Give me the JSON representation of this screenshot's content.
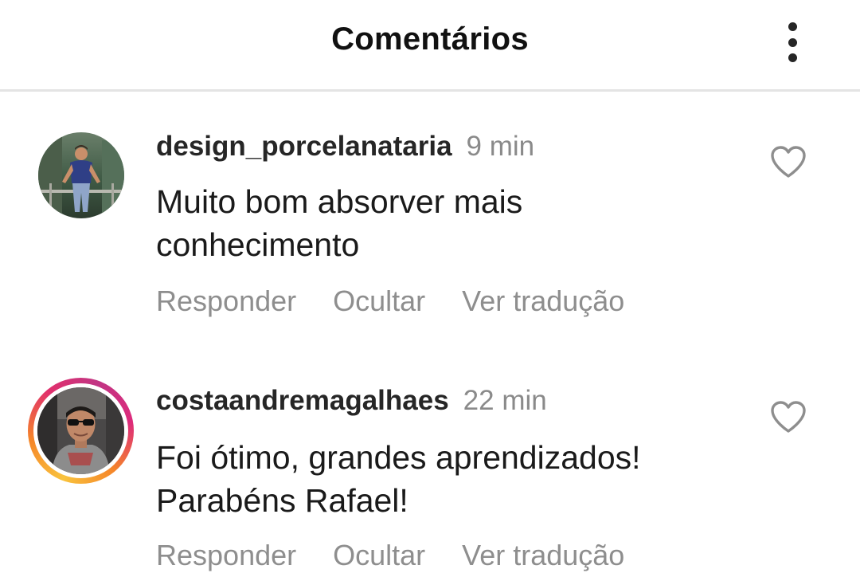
{
  "header": {
    "title": "Comentários",
    "more_icon": "more-vertical-icon"
  },
  "comments": [
    {
      "username": "design_porcelanataria",
      "time": "9 min",
      "text": "Muito bom absorver mais conhecimento",
      "reply_label": "Responder",
      "hide_label": "Ocultar",
      "translate_label": "Ver tradução",
      "has_story_ring": false,
      "like_icon": "heart-outline-icon"
    },
    {
      "username": "costaandremagalhaes",
      "time": "22 min",
      "text": "Foi ótimo, grandes aprendizados! Parabéns Rafael!",
      "reply_label": "Responder",
      "hide_label": "Ocultar",
      "translate_label": "Ver tradução",
      "has_story_ring": true,
      "like_icon": "heart-outline-icon"
    }
  ],
  "colors": {
    "text_primary": "#262626",
    "text_secondary": "#8e8e8e",
    "divider": "#e4e4e4",
    "story_ring": [
      "#f9c33d",
      "#f58529",
      "#e1306c",
      "#c13584"
    ]
  }
}
